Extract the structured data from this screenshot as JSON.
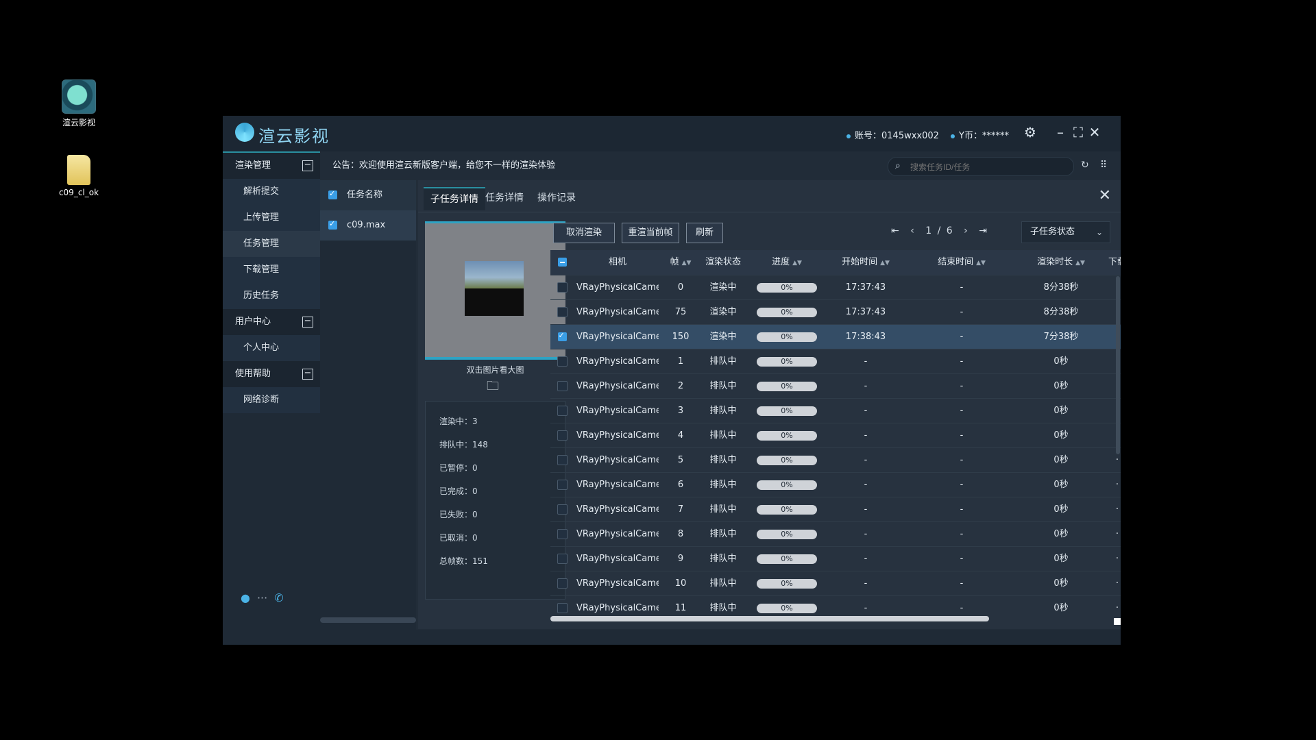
{
  "desktop": {
    "icons": [
      {
        "label": "渲云影视"
      },
      {
        "label": "c09_cl_ok"
      }
    ]
  },
  "app": {
    "title": "渲云影视",
    "account": "账号：0145wxx002",
    "balance": "Y币：******"
  },
  "sidebar": {
    "groups": [
      {
        "label": "渲染管理",
        "items": [
          "解析提交",
          "上传管理",
          "任务管理",
          "下载管理",
          "历史任务"
        ]
      },
      {
        "label": "用户中心",
        "items": [
          "个人中心"
        ]
      },
      {
        "label": "使用帮助",
        "items": [
          "网络诊断"
        ]
      }
    ]
  },
  "notice": "公告：欢迎使用渲云新版客户端，给您不一样的渲染体验",
  "search": {
    "placeholder": "搜索任务ID/任务"
  },
  "task_list": {
    "header": "任务名称",
    "items": [
      "c09.max"
    ]
  },
  "tabs": [
    "子任务详情",
    "任务详情",
    "操作记录"
  ],
  "preview": {
    "caption": "双击图片看大图"
  },
  "stats": [
    "渲染中：3",
    "排队中：148",
    "已暂停：0",
    "已完成：0",
    "已失败：0",
    "已取消：0",
    "总帧数：151"
  ],
  "actions": {
    "cancel": "取消渲染",
    "rerender": "重渲当前帧",
    "refresh": "刷新"
  },
  "pager": {
    "current": "1",
    "separator": "/",
    "total": "6"
  },
  "status_filter": "子任务状态",
  "table": {
    "headers": {
      "camera": "相机",
      "frame": "帧",
      "status": "渲染状态",
      "progress": "进度",
      "start": "开始时间",
      "end": "结束时间",
      "duration": "渲染时长",
      "more": "下载"
    },
    "rows": [
      {
        "camera": "VRayPhysicalCamer...",
        "frame": "0",
        "status": "渲染中",
        "progress": "0%",
        "start": "17:37:43",
        "end": "-",
        "duration": "8分38秒",
        "checked": false
      },
      {
        "camera": "VRayPhysicalCamer...",
        "frame": "75",
        "status": "渲染中",
        "progress": "0%",
        "start": "17:37:43",
        "end": "-",
        "duration": "8分38秒",
        "checked": false
      },
      {
        "camera": "VRayPhysicalCamer...",
        "frame": "150",
        "status": "渲染中",
        "progress": "0%",
        "start": "17:38:43",
        "end": "-",
        "duration": "7分38秒",
        "checked": true
      },
      {
        "camera": "VRayPhysicalCamer...",
        "frame": "1",
        "status": "排队中",
        "progress": "0%",
        "start": "-",
        "end": "-",
        "duration": "0秒",
        "checked": false
      },
      {
        "camera": "VRayPhysicalCamer...",
        "frame": "2",
        "status": "排队中",
        "progress": "0%",
        "start": "-",
        "end": "-",
        "duration": "0秒",
        "checked": false
      },
      {
        "camera": "VRayPhysicalCamer...",
        "frame": "3",
        "status": "排队中",
        "progress": "0%",
        "start": "-",
        "end": "-",
        "duration": "0秒",
        "checked": false
      },
      {
        "camera": "VRayPhysicalCamer...",
        "frame": "4",
        "status": "排队中",
        "progress": "0%",
        "start": "-",
        "end": "-",
        "duration": "0秒",
        "checked": false
      },
      {
        "camera": "VRayPhysicalCamer...",
        "frame": "5",
        "status": "排队中",
        "progress": "0%",
        "start": "-",
        "end": "-",
        "duration": "0秒",
        "checked": false
      },
      {
        "camera": "VRayPhysicalCamer...",
        "frame": "6",
        "status": "排队中",
        "progress": "0%",
        "start": "-",
        "end": "-",
        "duration": "0秒",
        "checked": false
      },
      {
        "camera": "VRayPhysicalCamer...",
        "frame": "7",
        "status": "排队中",
        "progress": "0%",
        "start": "-",
        "end": "-",
        "duration": "0秒",
        "checked": false
      },
      {
        "camera": "VRayPhysicalCamer...",
        "frame": "8",
        "status": "排队中",
        "progress": "0%",
        "start": "-",
        "end": "-",
        "duration": "0秒",
        "checked": false
      },
      {
        "camera": "VRayPhysicalCamer...",
        "frame": "9",
        "status": "排队中",
        "progress": "0%",
        "start": "-",
        "end": "-",
        "duration": "0秒",
        "checked": false
      },
      {
        "camera": "VRayPhysicalCamer...",
        "frame": "10",
        "status": "排队中",
        "progress": "0%",
        "start": "-",
        "end": "-",
        "duration": "0秒",
        "checked": false
      },
      {
        "camera": "VRayPhysicalCamer...",
        "frame": "11",
        "status": "排队中",
        "progress": "0%",
        "start": "-",
        "end": "-",
        "duration": "0秒",
        "checked": false
      }
    ]
  },
  "colors": {
    "accent": "#2a8fa0",
    "progress": "#4bb3e6",
    "selected_row": "#344d66"
  }
}
